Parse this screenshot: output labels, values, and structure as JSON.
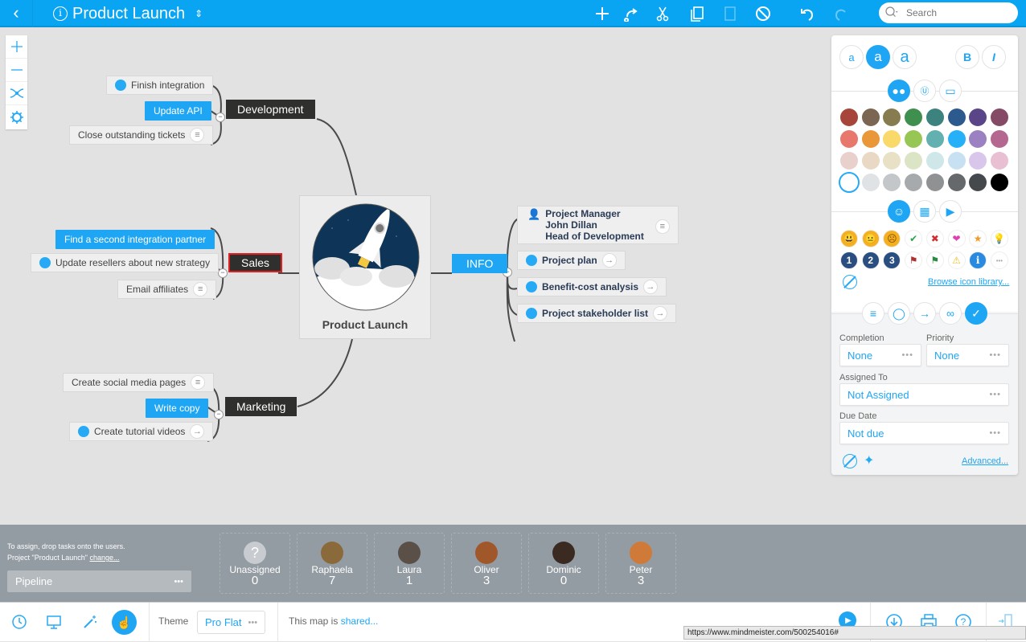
{
  "topbar": {
    "title": "Product Launch",
    "back_icon": "chevron-left-icon",
    "tools": [
      "add-icon",
      "connect-icon",
      "cut-icon",
      "copy-icon",
      "paste-icon",
      "delete-icon",
      "undo-icon",
      "redo-icon"
    ],
    "search_placeholder": "Search"
  },
  "left_tools": [
    "zoom-in-icon",
    "zoom-out-icon",
    "layout-icon",
    "settings-icon"
  ],
  "map": {
    "center": {
      "label": "Product Launch"
    },
    "branches": {
      "development": {
        "label": "Development",
        "children": [
          {
            "label": "Finish integration",
            "dot": true
          },
          {
            "label": "Update API",
            "highlight": true
          },
          {
            "label": "Close outstanding tickets",
            "note": true
          }
        ]
      },
      "sales": {
        "label": "Sales",
        "children": [
          {
            "label": "Find a second integration partner",
            "highlight": true
          },
          {
            "label": "Update resellers about new strategy",
            "dot": true
          },
          {
            "label": "Email affiliates",
            "note": true
          }
        ]
      },
      "marketing": {
        "label": "Marketing",
        "children": [
          {
            "label": "Create social media pages",
            "note": true
          },
          {
            "label": "Write copy",
            "highlight": true
          },
          {
            "label": "Create tutorial videos",
            "dot": true,
            "link": true
          }
        ]
      },
      "info": {
        "label": "INFO",
        "children": [
          {
            "lines": [
              "Project Manager",
              "John Dillan",
              "Head of Development"
            ],
            "note": true
          },
          {
            "label": "Project plan",
            "dot": true,
            "link": true
          },
          {
            "label": "Benefit-cost analysis",
            "dot": true,
            "link": true
          },
          {
            "label": "Project stakeholder list",
            "dot": true,
            "link": true
          }
        ]
      }
    }
  },
  "panel": {
    "font_sizes": [
      "a",
      "a",
      "a"
    ],
    "bold": "B",
    "italic": "I",
    "style_tabs": [
      "color-icon",
      "text-color-icon",
      "shape-icon"
    ],
    "colors": [
      [
        "#a8453b",
        "#7a6652",
        "#877c4f",
        "#3f8f4f",
        "#3c8380",
        "#2c5a8f",
        "#5a4589",
        "#844a66"
      ],
      [
        "#e8776c",
        "#ea973a",
        "#f8d96a",
        "#98c655",
        "#62b0b0",
        "#26b0f7",
        "#9b80c2",
        "#b5688f"
      ],
      [
        "#e8d0cd",
        "#e9d8c4",
        "#e8e1c6",
        "#dbe4c5",
        "#cfe7e8",
        "#c8e1f2",
        "#d8c7ea",
        "#e9bfd4"
      ],
      [
        "#ffffff",
        "#dfe3e6",
        "#c4c7ca",
        "#a7aaad",
        "#8f9193",
        "#66696c",
        "#46494c",
        "#000000"
      ]
    ],
    "icon_tabs": [
      "emoji-icon",
      "image-icon",
      "video-icon"
    ],
    "icons_row1": [
      "😃",
      "😐",
      "☹",
      "✔",
      "✖",
      "❤",
      "★",
      "💡"
    ],
    "icons_row2": [
      "1",
      "2",
      "3",
      "⚑",
      "⚑",
      "⚠",
      "i",
      "•••"
    ],
    "browse_link": "Browse icon library...",
    "attach_tabs": [
      "note-icon",
      "comment-icon",
      "link-icon",
      "attachment-icon",
      "task-icon"
    ],
    "completion_label": "Completion",
    "completion_value": "None",
    "priority_label": "Priority",
    "priority_value": "None",
    "assigned_label": "Assigned To",
    "assigned_value": "Not Assigned",
    "due_label": "Due Date",
    "due_value": "Not due",
    "advanced_link": "Advanced...",
    "more": "•••"
  },
  "assign": {
    "hint1": "To assign, drop tasks onto the users.",
    "hint2": "Project \"Product Launch\"",
    "change_link": "change...",
    "pipeline": "Pipeline",
    "users": [
      {
        "name": "Unassigned",
        "count": "0",
        "color": "#c8ccd0"
      },
      {
        "name": "Raphaela",
        "count": "7",
        "color": "#8a6a3a"
      },
      {
        "name": "Laura",
        "count": "1",
        "color": "#5a5048"
      },
      {
        "name": "Oliver",
        "count": "3",
        "color": "#a0582a"
      },
      {
        "name": "Dominic",
        "count": "0",
        "color": "#3a2a22"
      },
      {
        "name": "Peter",
        "count": "3",
        "color": "#d07a3a"
      }
    ]
  },
  "bottombar": {
    "theme_label": "Theme",
    "theme_value": "Pro Flat",
    "shared_prefix": "This map is ",
    "shared_link": "shared...",
    "status_url": "https://www.mindmeister.com/500254016#"
  }
}
